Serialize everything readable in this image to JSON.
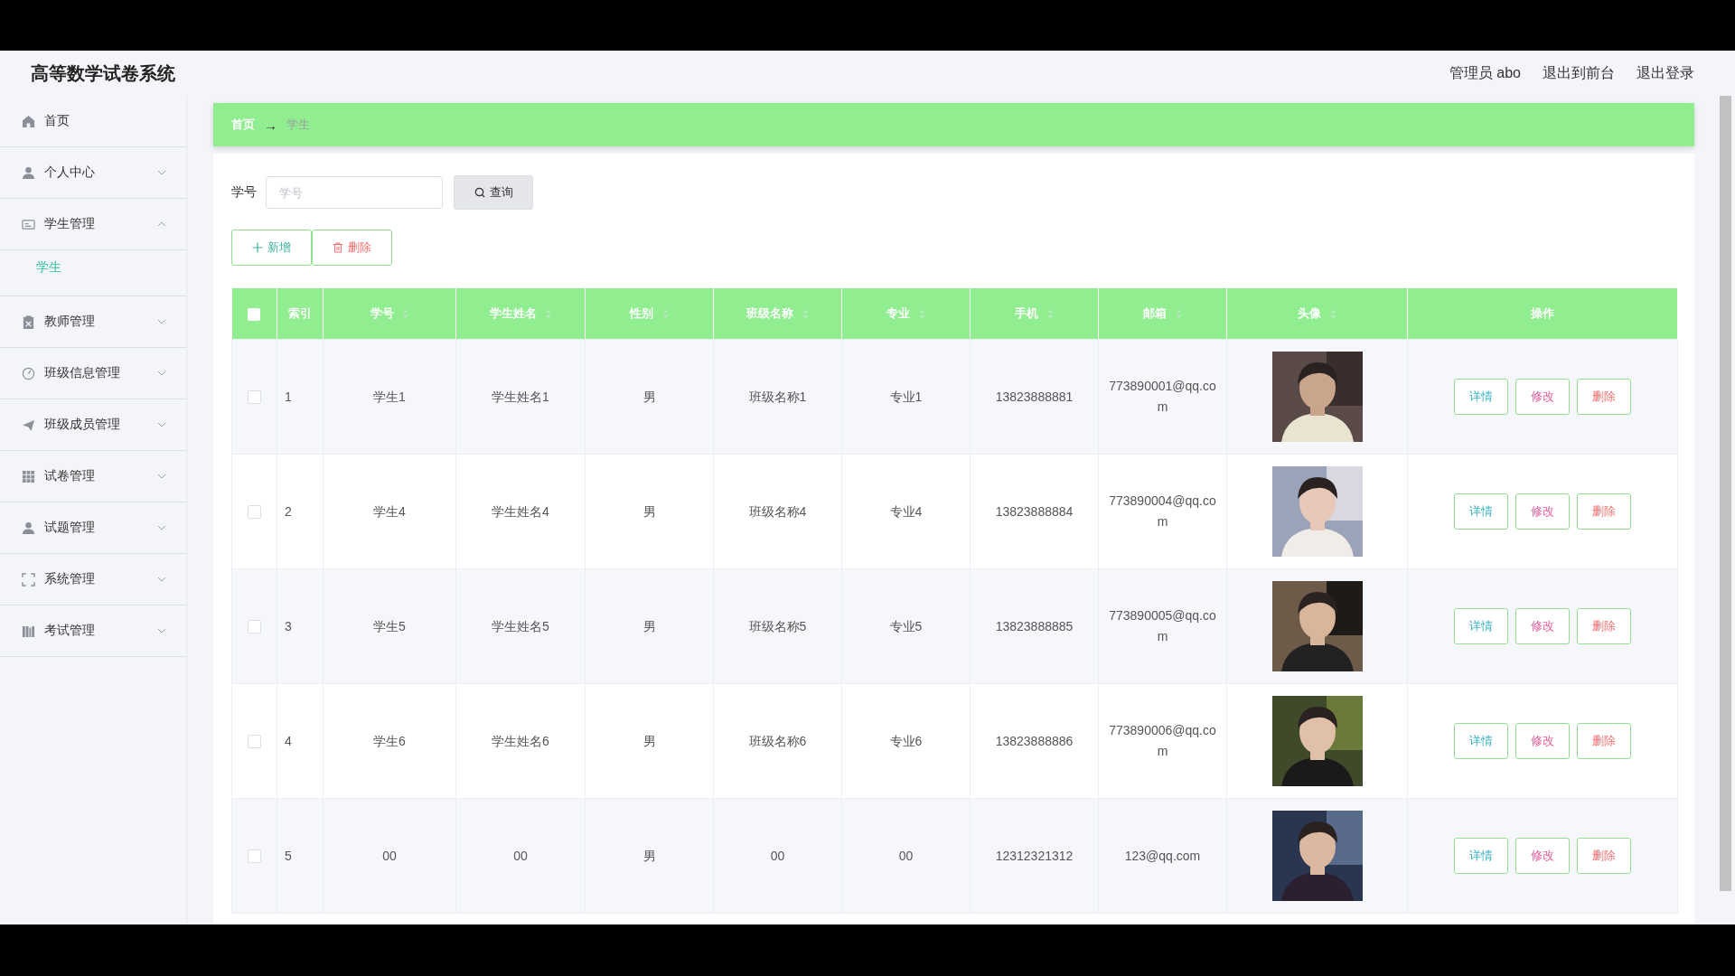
{
  "header": {
    "title": "高等数学试卷系统",
    "links": [
      "管理员 abo",
      "退出到前台",
      "退出登录"
    ]
  },
  "sidebar": {
    "items": [
      {
        "label": "首页"
      },
      {
        "label": "个人中心",
        "expanded": false
      },
      {
        "label": "学生管理",
        "expanded": true,
        "children": [
          {
            "label": "学生",
            "selected": true
          }
        ]
      },
      {
        "label": "教师管理",
        "expanded": false
      },
      {
        "label": "班级信息管理",
        "expanded": false
      },
      {
        "label": "班级成员管理",
        "expanded": false
      },
      {
        "label": "试卷管理",
        "expanded": false
      },
      {
        "label": "试题管理",
        "expanded": false
      },
      {
        "label": "系统管理",
        "expanded": false
      },
      {
        "label": "考试管理",
        "expanded": false
      }
    ]
  },
  "breadcrumb": {
    "home": "首页",
    "separator": "→",
    "current": "学生"
  },
  "search": {
    "label": "学号",
    "placeholder": "学号",
    "button": "查询"
  },
  "toolbar": {
    "add": "新增",
    "delete": "删除"
  },
  "table": {
    "select_all": {
      "checked": false
    },
    "columns": [
      {
        "label": "索引",
        "sortable": false
      },
      {
        "label": "学号",
        "sortable": true
      },
      {
        "label": "学生姓名",
        "sortable": true
      },
      {
        "label": "性别",
        "sortable": true
      },
      {
        "label": "班级名称",
        "sortable": true
      },
      {
        "label": "专业",
        "sortable": true
      },
      {
        "label": "手机",
        "sortable": true
      },
      {
        "label": "邮箱",
        "sortable": true
      },
      {
        "label": "头像",
        "sortable": true
      },
      {
        "label": "操作",
        "sortable": false
      }
    ],
    "rows": [
      {
        "checked": false,
        "cells": [
          "1",
          "学生1",
          "学生姓名1",
          "男",
          "班级名称1",
          "专业1",
          "13823888881",
          "773890001@qq.com"
        ],
        "actions": [
          "详情",
          "修改",
          "删除"
        ]
      },
      {
        "checked": false,
        "cells": [
          "2",
          "学生4",
          "学生姓名4",
          "男",
          "班级名称4",
          "专业4",
          "13823888884",
          "773890004@qq.com"
        ],
        "actions": [
          "详情",
          "修改",
          "删除"
        ]
      },
      {
        "checked": false,
        "cells": [
          "3",
          "学生5",
          "学生姓名5",
          "男",
          "班级名称5",
          "专业5",
          "13823888885",
          "773890005@qq.com"
        ],
        "actions": [
          "详情",
          "修改",
          "删除"
        ]
      },
      {
        "checked": false,
        "cells": [
          "4",
          "学生6",
          "学生姓名6",
          "男",
          "班级名称6",
          "专业6",
          "13823888886",
          "773890006@qq.com"
        ],
        "actions": [
          "详情",
          "修改",
          "删除"
        ]
      },
      {
        "checked": false,
        "cells": [
          "5",
          "00",
          "00",
          "男",
          "00",
          "00",
          "12312321312",
          "123@qq.com"
        ],
        "actions": [
          "详情",
          "修改",
          "删除"
        ]
      }
    ]
  }
}
